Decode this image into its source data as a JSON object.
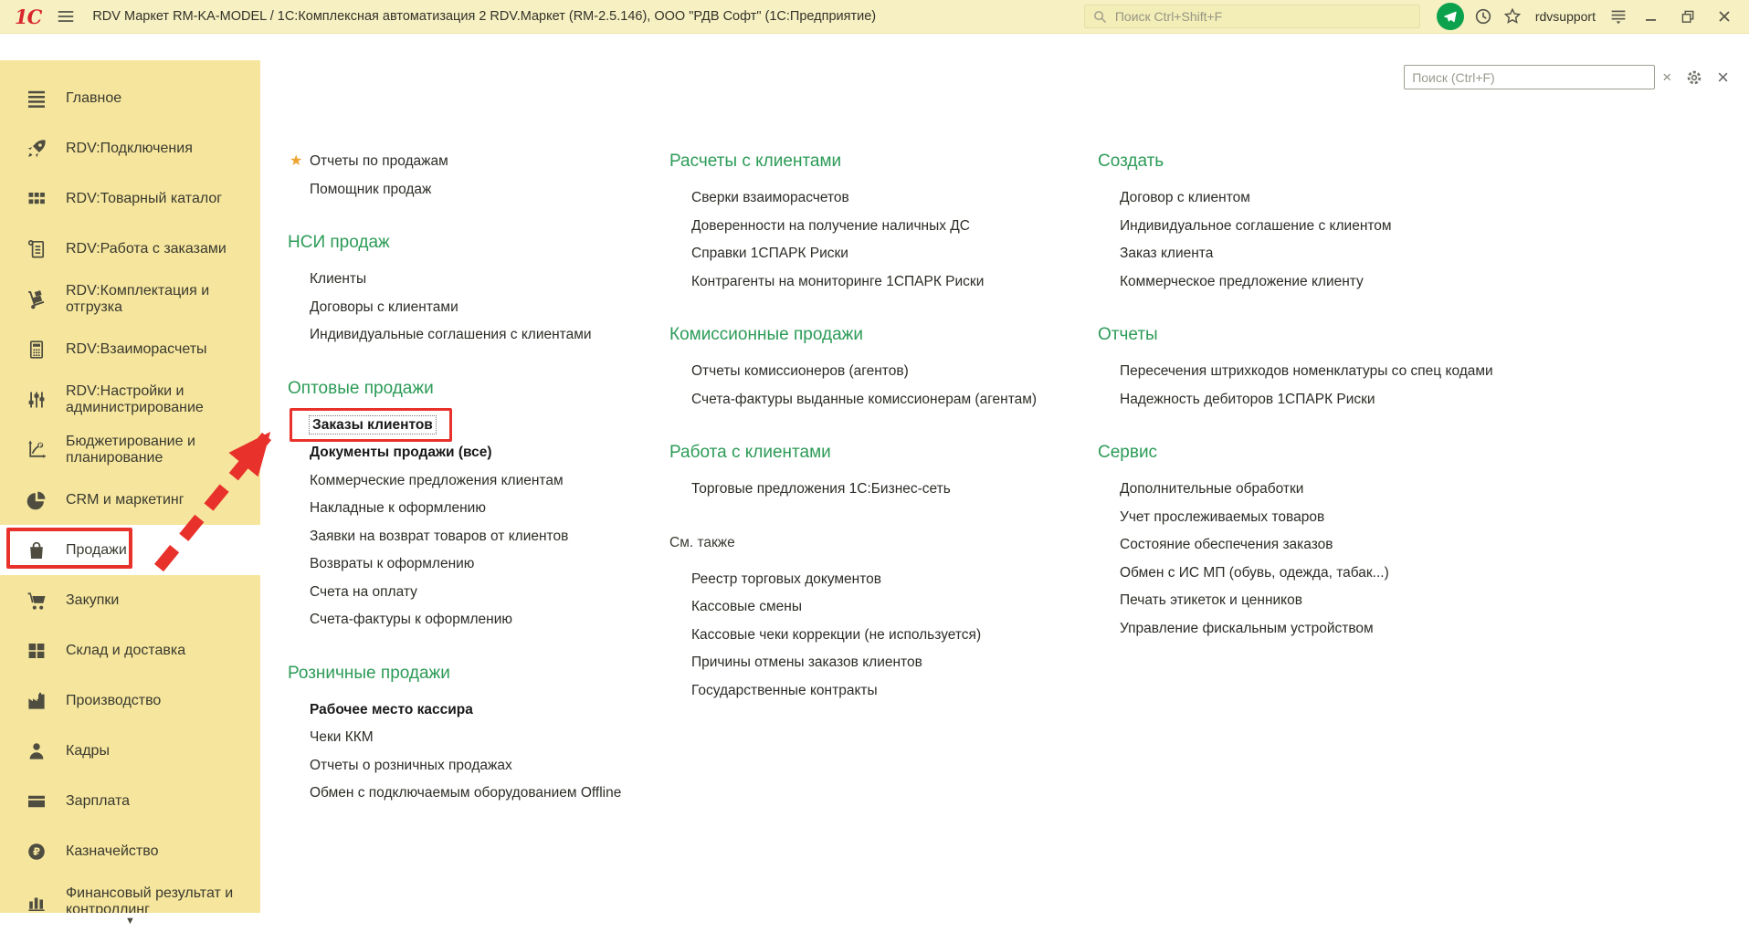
{
  "titlebar": {
    "logo_text": "1С",
    "title": "RDV Маркет RM-KA-MODEL / 1С:Комплексная автоматизация 2 RDV.Маркет (RM-2.5.146), ООО \"РДВ Софт\" (1С:Предприятие)",
    "search_placeholder": "Поиск Ctrl+Shift+F",
    "user": "rdvsupport"
  },
  "colors": {
    "heading_green": "#2c9b57",
    "annotation_red": "#e8312a",
    "star_orange": "#f0a22e",
    "messenger_green": "#0ca24d",
    "sidebar_yellow": "#f6e69d",
    "titlebar_yellow": "#f7f0c2"
  },
  "sidebar": {
    "more_symbol": "▼",
    "items": [
      {
        "label": "Главное",
        "icon": "menu-icon"
      },
      {
        "label": "RDV:Подключения",
        "icon": "rocket-icon"
      },
      {
        "label": "RDV:Товарный каталог",
        "icon": "catalog-grid-icon"
      },
      {
        "label": "RDV:Работа с заказами",
        "icon": "order-clipboard-icon"
      },
      {
        "label": "RDV:Комплектация и отгрузка",
        "icon": "handtruck-icon"
      },
      {
        "label": "RDV:Взаиморасчеты",
        "icon": "calculator-icon"
      },
      {
        "label": "RDV:Настройки и администрирование",
        "icon": "sliders-icon"
      },
      {
        "label": "Бюджетирование и планирование",
        "icon": "plan-chart-icon"
      },
      {
        "label": "CRM и маркетинг",
        "icon": "pie-chart-icon"
      },
      {
        "label": "Продажи",
        "icon": "shopping-bag-icon",
        "selected": true,
        "annotated": true
      },
      {
        "label": "Закупки",
        "icon": "cart-icon"
      },
      {
        "label": "Склад и доставка",
        "icon": "warehouse-icon"
      },
      {
        "label": "Производство",
        "icon": "factory-icon"
      },
      {
        "label": "Кадры",
        "icon": "person-icon"
      },
      {
        "label": "Зарплата",
        "icon": "payment-card-icon"
      },
      {
        "label": "Казначейство",
        "icon": "ruble-icon"
      },
      {
        "label": "Финансовый результат и контроллинг",
        "icon": "bar-chart-icon"
      }
    ]
  },
  "panel": {
    "search_placeholder": "Поиск (Ctrl+F)",
    "columns": [
      {
        "sections": [
          {
            "heading": null,
            "items": [
              {
                "label": "Отчеты по продажам",
                "starred": true
              },
              {
                "label": "Помощник продаж"
              }
            ]
          },
          {
            "heading": "НСИ продаж",
            "items": [
              {
                "label": "Клиенты"
              },
              {
                "label": "Договоры с клиентами"
              },
              {
                "label": "Индивидуальные соглашения с клиентами"
              }
            ]
          },
          {
            "heading": "Оптовые продажи",
            "items": [
              {
                "label": "Заказы клиентов",
                "bold": true,
                "highlighted": true
              },
              {
                "label": "Документы продажи (все)",
                "bold": true
              },
              {
                "label": "Коммерческие предложения клиентам"
              },
              {
                "label": "Накладные к оформлению"
              },
              {
                "label": "Заявки на возврат товаров от клиентов"
              },
              {
                "label": "Возвраты к оформлению"
              },
              {
                "label": "Счета на оплату"
              },
              {
                "label": "Счета-фактуры к оформлению"
              }
            ]
          },
          {
            "heading": "Розничные продажи",
            "items": [
              {
                "label": "Рабочее место кассира",
                "bold": true
              },
              {
                "label": "Чеки ККМ"
              },
              {
                "label": "Отчеты о розничных продажах"
              },
              {
                "label": "Обмен с подключаемым оборудованием Offline"
              }
            ]
          }
        ]
      },
      {
        "sections": [
          {
            "heading": "Расчеты с клиентами",
            "items": [
              {
                "label": "Сверки взаиморасчетов"
              },
              {
                "label": "Доверенности на получение наличных ДС"
              },
              {
                "label": "Справки 1СПАРК Риски"
              },
              {
                "label": "Контрагенты на мониторинге 1СПАРК Риски"
              }
            ]
          },
          {
            "heading": "Комиссионные продажи",
            "items": [
              {
                "label": "Отчеты комиссионеров (агентов)"
              },
              {
                "label": "Счета-фактуры выданные комиссионерам (агентам)"
              }
            ]
          },
          {
            "heading": "Работа с клиентами",
            "items": [
              {
                "label": "Торговые предложения 1С:Бизнес-сеть"
              }
            ]
          },
          {
            "heading": "См. также",
            "plain": true,
            "items": [
              {
                "label": "Реестр торговых документов"
              },
              {
                "label": "Кассовые смены"
              },
              {
                "label": "Кассовые чеки коррекции (не используется)"
              },
              {
                "label": "Причины отмены заказов клиентов"
              },
              {
                "label": "Государственные контракты"
              }
            ]
          }
        ]
      },
      {
        "sections": [
          {
            "heading": "Создать",
            "items": [
              {
                "label": "Договор с клиентом"
              },
              {
                "label": "Индивидуальное соглашение с клиентом"
              },
              {
                "label": "Заказ клиента"
              },
              {
                "label": "Коммерческое предложение клиенту"
              }
            ]
          },
          {
            "heading": "Отчеты",
            "items": [
              {
                "label": "Пересечения штрихкодов номенклатуры со спец кодами"
              },
              {
                "label": "Надежность дебиторов 1СПАРК Риски"
              }
            ]
          },
          {
            "heading": "Сервис",
            "items": [
              {
                "label": "Дополнительные обработки"
              },
              {
                "label": "Учет прослеживаемых товаров"
              },
              {
                "label": "Состояние обеспечения заказов"
              },
              {
                "label": "Обмен с ИС МП (обувь, одежда, табак...)"
              },
              {
                "label": "Печать этикеток и ценников"
              },
              {
                "label": "Управление фискальным устройством"
              }
            ]
          }
        ]
      }
    ]
  }
}
